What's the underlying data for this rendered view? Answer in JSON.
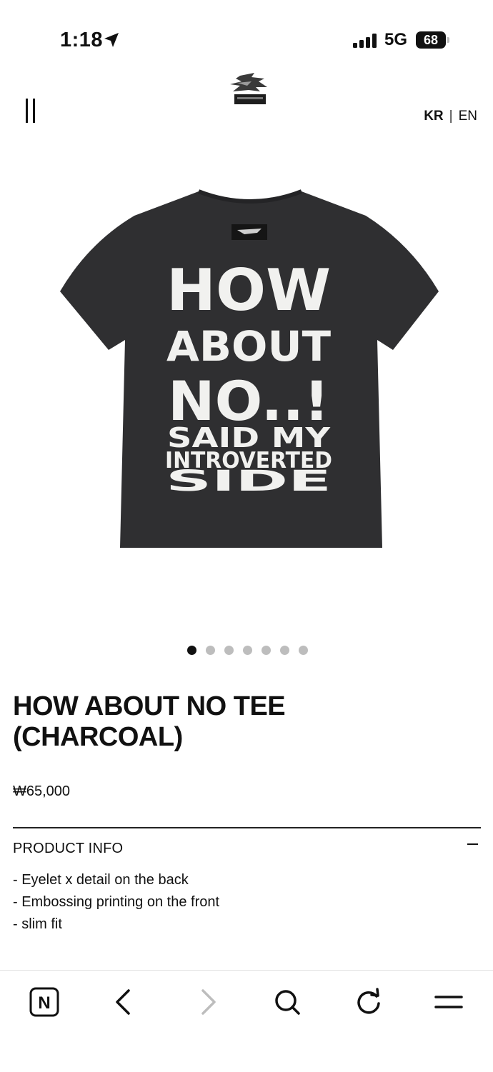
{
  "status_bar": {
    "time": "1:18",
    "network": "5G",
    "battery": "68"
  },
  "header": {
    "lang_kr": "KR",
    "lang_separator": "|",
    "lang_en": "EN"
  },
  "carousel": {
    "total_slides": 7,
    "active_index": 0
  },
  "product": {
    "title_line1": "HOW ABOUT NO TEE",
    "title_line2": "(CHARCOAL)",
    "price": "₩65,000",
    "info_heading": "PRODUCT INFO",
    "details": [
      "- Eyelet x detail on the back",
      "- Embossing printing on the front",
      "- slim fit"
    ],
    "print_lines": [
      "HOW",
      "ABOUT",
      "NO..!",
      "SAID MY",
      "INTROVERTED",
      "SIDE"
    ],
    "tee_color": "#2f2f31"
  },
  "bottom_bar": {
    "home_glyph": "N"
  },
  "icons": [
    "location-arrow-icon",
    "signal-icon",
    "battery-icon",
    "menu-icon",
    "logo",
    "naver-home-icon",
    "back-icon",
    "forward-icon",
    "search-icon",
    "refresh-icon",
    "hamburger-icon"
  ]
}
